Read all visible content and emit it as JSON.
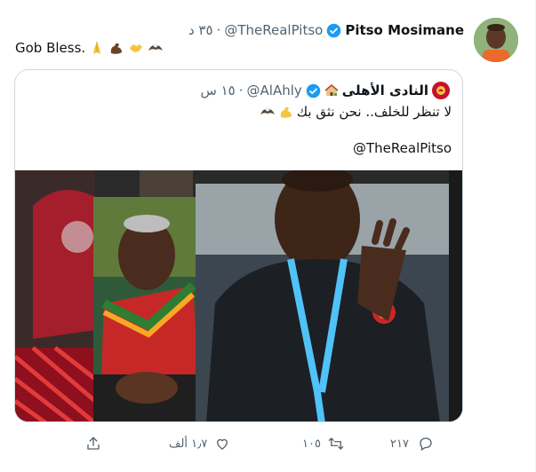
{
  "tweet": {
    "author_name": "Pitso Mosimane",
    "handle": "@TheRealPitso",
    "separator": "·",
    "time": "٣٥ د",
    "text": "Gob Bless.",
    "emojis": [
      "folded-hands-emoji",
      "flexed-biceps-emoji",
      "handshake-emoji",
      "eagle-emoji"
    ]
  },
  "quote": {
    "author_name": "النادى الأهلى",
    "handle": "@AlAhly",
    "separator": "·",
    "time": "١٥ س",
    "text": "لا تنظر للخلف.. نحن نثق بك",
    "emojis": [
      "flexed-biceps-emoji",
      "eagle-emoji"
    ],
    "mention": "@TheRealPitso"
  },
  "actions": {
    "reply_count": "٢١٧",
    "retweet_count": "١٠٥",
    "like_count": "١٫٧ ألف"
  },
  "colors": {
    "verified": "#1d9bf0",
    "muted": "#536471",
    "border": "#cfd9de",
    "ahly_red": "#c8102e"
  }
}
